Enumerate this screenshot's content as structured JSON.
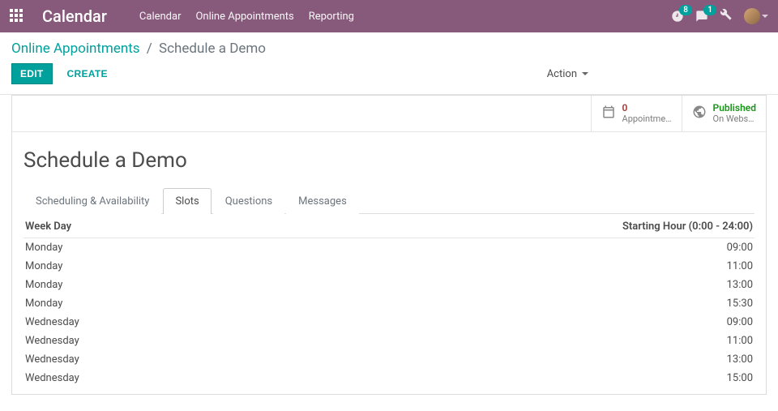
{
  "navbar": {
    "brand": "Calendar",
    "links": [
      "Calendar",
      "Online Appointments",
      "Reporting"
    ],
    "activities_count": "8",
    "messages_count": "1"
  },
  "breadcrumb": {
    "parent": "Online Appointments",
    "current": "Schedule a Demo"
  },
  "buttons": {
    "edit": "EDIT",
    "create": "CREATE",
    "action": "Action"
  },
  "statbtns": {
    "appt": {
      "value": "0",
      "label": "Appointme…"
    },
    "pub": {
      "value": "Published",
      "label": "On Webs…"
    }
  },
  "record": {
    "title": "Schedule a Demo"
  },
  "tabs": {
    "t0": "Scheduling & Availability",
    "t1": "Slots",
    "t2": "Questions",
    "t3": "Messages"
  },
  "table": {
    "h_day": "Week Day",
    "h_hour": "Starting Hour (0:00 - 24:00)",
    "rows": [
      {
        "day": "Monday",
        "hour": "09:00"
      },
      {
        "day": "Monday",
        "hour": "11:00"
      },
      {
        "day": "Monday",
        "hour": "13:00"
      },
      {
        "day": "Monday",
        "hour": "15:30"
      },
      {
        "day": "Wednesday",
        "hour": "09:00"
      },
      {
        "day": "Wednesday",
        "hour": "11:00"
      },
      {
        "day": "Wednesday",
        "hour": "13:00"
      },
      {
        "day": "Wednesday",
        "hour": "15:00"
      }
    ]
  }
}
